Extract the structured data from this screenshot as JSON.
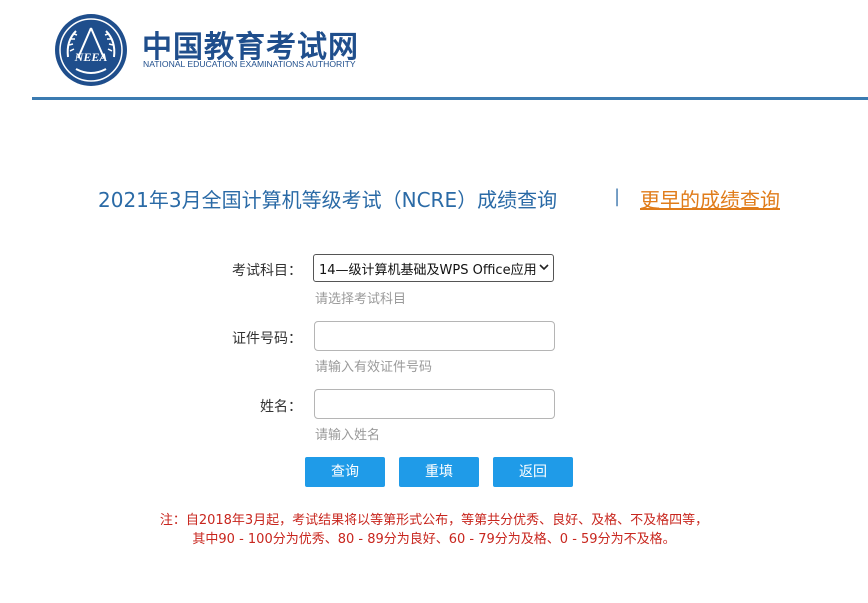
{
  "header": {
    "brand_cn": "中国教育考试网",
    "brand_en": "NATIONAL EDUCATION EXAMINATIONS AUTHORITY",
    "logo_text": "NEEA"
  },
  "title": {
    "main": "2021年3月全国计算机等级考试（NCRE）成绩查询",
    "separator": "|",
    "earlier_link": "更早的成绩查询"
  },
  "form": {
    "subject_label": "考试科目：",
    "subject_value": "14—级计算机基础及WPS Office应用",
    "subject_hint": "请选择考试科目",
    "id_label": "证件号码：",
    "id_value": "",
    "id_hint": "请输入有效证件号码",
    "name_label": "姓名：",
    "name_value": "",
    "name_hint": "请输入姓名"
  },
  "buttons": {
    "query": "查询",
    "reset": "重填",
    "back": "返回"
  },
  "note": {
    "line1": "注：自2018年3月起，考试结果将以等第形式公布，等第共分优秀、良好、及格、不及格四等，",
    "line2": "其中90 - 100分为优秀、80 - 89分为良好、60 - 79分为及格、0 - 59分为不及格。"
  },
  "colors": {
    "brand": "#1f4e8c",
    "title": "#2a6aa6",
    "link": "#e07c1a",
    "button": "#1f9be8",
    "note": "#c8261e"
  }
}
